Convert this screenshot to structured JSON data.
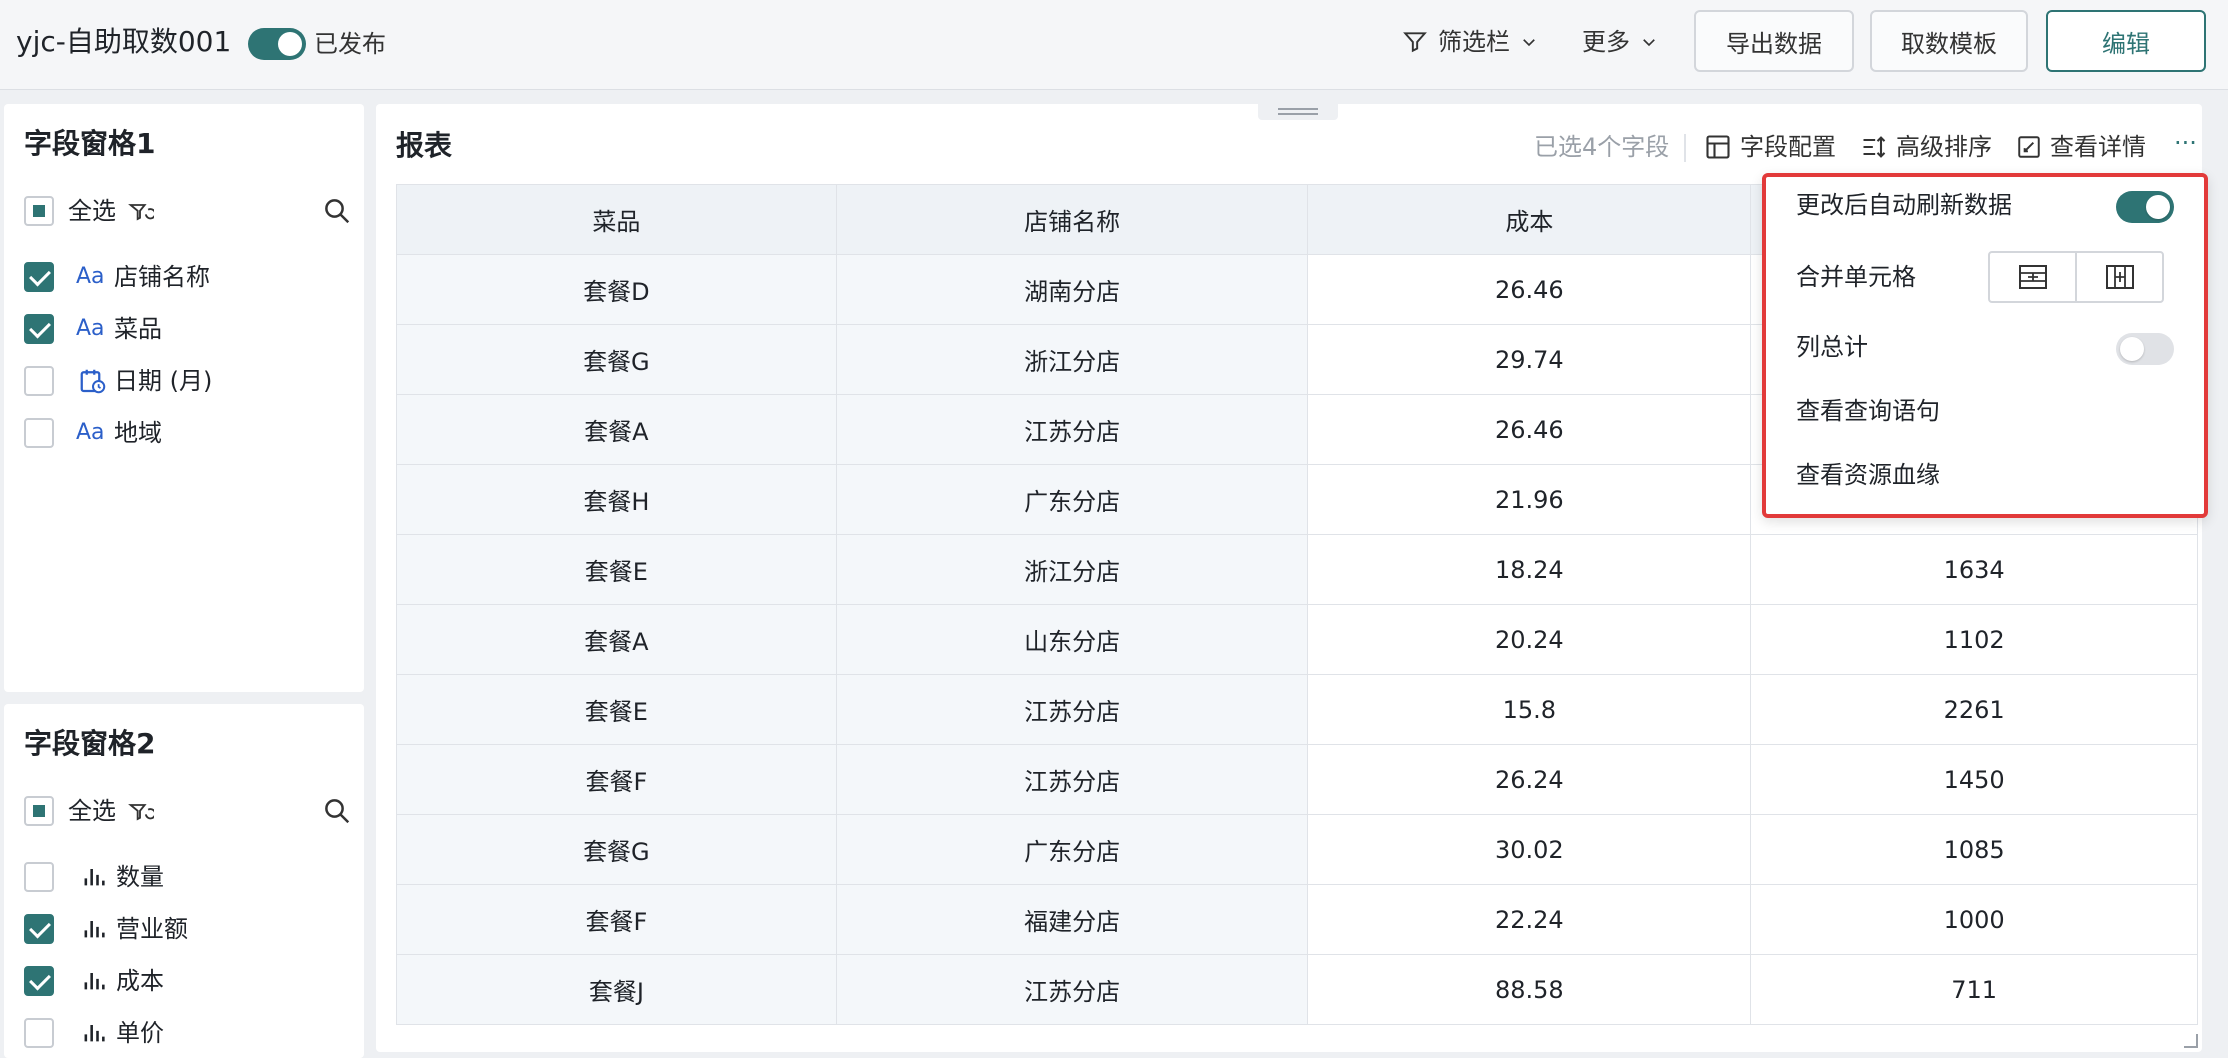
{
  "header": {
    "title": "yjc-自助取数001",
    "published_label": "已发布",
    "filter_label": "筛选栏",
    "more_label": "更多",
    "export_label": "导出数据",
    "template_label": "取数模板",
    "edit_label": "编辑"
  },
  "panel1": {
    "title": "字段窗格1",
    "select_all": "全选",
    "fields": [
      {
        "label": "店铺名称",
        "icon": "text-field-icon",
        "glyph": "Aa",
        "checked": true
      },
      {
        "label": "菜品",
        "icon": "text-field-icon",
        "glyph": "Aa",
        "checked": true
      },
      {
        "label": "日期 (月)",
        "icon": "date-field-icon",
        "glyph": "",
        "checked": false
      },
      {
        "label": "地域",
        "icon": "text-field-icon",
        "glyph": "Aa",
        "checked": false
      }
    ]
  },
  "panel2": {
    "title": "字段窗格2",
    "select_all": "全选",
    "fields": [
      {
        "label": "数量",
        "checked": false
      },
      {
        "label": "营业额",
        "checked": true
      },
      {
        "label": "成本",
        "checked": true
      },
      {
        "label": "单价",
        "checked": false
      }
    ]
  },
  "report": {
    "title": "报表",
    "selected_count": "已选4个字段",
    "field_config": "字段配置",
    "advanced_sort": "高级排序",
    "view_detail": "查看详情",
    "more": "···",
    "columns": [
      "菜品",
      "店铺名称",
      "成本",
      ""
    ],
    "rows": [
      [
        "套餐D",
        "湖南分店",
        "26.46",
        ""
      ],
      [
        "套餐G",
        "浙江分店",
        "29.74",
        ""
      ],
      [
        "套餐A",
        "江苏分店",
        "26.46",
        ""
      ],
      [
        "套餐H",
        "广东分店",
        "21.96",
        ""
      ],
      [
        "套餐E",
        "浙江分店",
        "18.24",
        "1634"
      ],
      [
        "套餐A",
        "山东分店",
        "20.24",
        "1102"
      ],
      [
        "套餐E",
        "江苏分店",
        "15.8",
        "2261"
      ],
      [
        "套餐F",
        "江苏分店",
        "26.24",
        "1450"
      ],
      [
        "套餐G",
        "广东分店",
        "30.02",
        "1085"
      ],
      [
        "套餐F",
        "福建分店",
        "22.24",
        "1000"
      ],
      [
        "套餐J",
        "江苏分店",
        "88.58",
        "711"
      ]
    ]
  },
  "dropdown": {
    "auto_refresh": "更改后自动刷新数据",
    "auto_refresh_on": true,
    "merge_cells": "合并单元格",
    "column_total": "列总计",
    "column_total_on": false,
    "view_query": "查看查询语句",
    "view_lineage": "查看资源血缘"
  },
  "colors": {
    "accent": "#2e7474",
    "highlight_border": "#e23a3a"
  }
}
